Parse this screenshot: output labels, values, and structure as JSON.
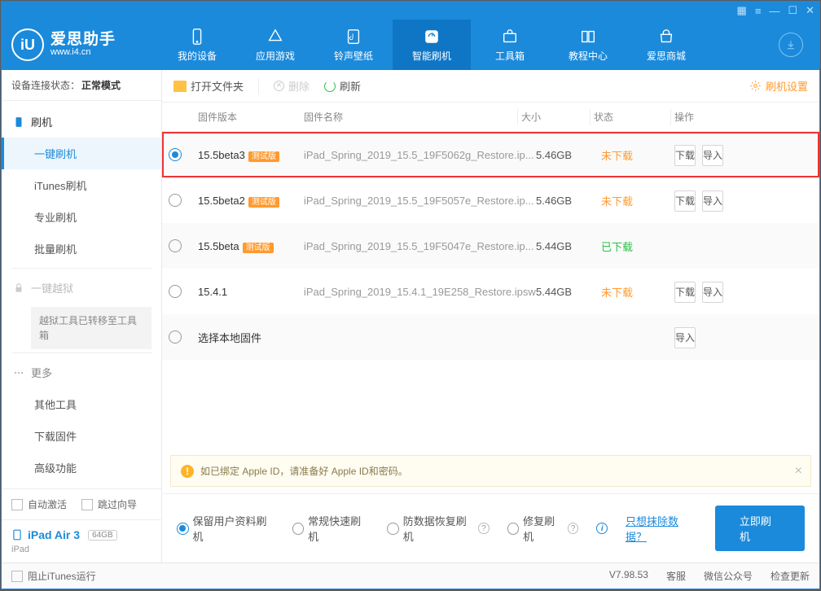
{
  "app": {
    "name": "爱思助手",
    "url": "www.i4.cn"
  },
  "nav": {
    "items": [
      {
        "label": "我的设备"
      },
      {
        "label": "应用游戏"
      },
      {
        "label": "铃声壁纸"
      },
      {
        "label": "智能刷机"
      },
      {
        "label": "工具箱"
      },
      {
        "label": "教程中心"
      },
      {
        "label": "爱思商城"
      }
    ]
  },
  "sidebar": {
    "conn_label": "设备连接状态：",
    "conn_value": "正常模式",
    "flash_head": "刷机",
    "items1": [
      "一键刷机",
      "iTunes刷机",
      "专业刷机",
      "批量刷机"
    ],
    "jb_head": "一键越狱",
    "jb_note": "越狱工具已转移至工具箱",
    "more_head": "更多",
    "items2": [
      "其他工具",
      "下载固件",
      "高级功能"
    ],
    "auto_activate": "自动激活",
    "skip_guide": "跳过向导",
    "device_name": "iPad Air 3",
    "device_cap": "64GB",
    "device_type": "iPad"
  },
  "toolbar": {
    "open": "打开文件夹",
    "delete": "删除",
    "refresh": "刷新",
    "settings": "刷机设置"
  },
  "table": {
    "h_ver": "固件版本",
    "h_name": "固件名称",
    "h_size": "大小",
    "h_status": "状态",
    "h_ops": "操作",
    "beta_tag": "测试版",
    "btn_dl": "下载",
    "btn_imp": "导入",
    "rows": [
      {
        "sel": true,
        "ver": "15.5beta3",
        "beta": true,
        "name": "iPad_Spring_2019_15.5_19F5062g_Restore.ip...",
        "size": "5.46GB",
        "status": "未下载",
        "status_cls": "nd",
        "dl": true,
        "imp": true
      },
      {
        "sel": false,
        "ver": "15.5beta2",
        "beta": true,
        "name": "iPad_Spring_2019_15.5_19F5057e_Restore.ip...",
        "size": "5.46GB",
        "status": "未下载",
        "status_cls": "nd",
        "dl": true,
        "imp": true
      },
      {
        "sel": false,
        "ver": "15.5beta",
        "beta": true,
        "name": "iPad_Spring_2019_15.5_19F5047e_Restore.ip...",
        "size": "5.44GB",
        "status": "已下载",
        "status_cls": "dl",
        "dl": false,
        "imp": false
      },
      {
        "sel": false,
        "ver": "15.4.1",
        "beta": false,
        "name": "iPad_Spring_2019_15.4.1_19E258_Restore.ipsw",
        "size": "5.44GB",
        "status": "未下载",
        "status_cls": "nd",
        "dl": true,
        "imp": true
      },
      {
        "sel": false,
        "ver": "选择本地固件",
        "beta": false,
        "name": "",
        "size": "",
        "status": "",
        "status_cls": "",
        "dl": false,
        "imp": true
      }
    ]
  },
  "notice": "如已绑定 Apple ID，请准备好 Apple ID和密码。",
  "options": {
    "o1": "保留用户资料刷机",
    "o2": "常规快速刷机",
    "o3": "防数据恢复刷机",
    "o4": "修复刷机",
    "link": "只想抹除数据？",
    "go": "立即刷机"
  },
  "statusbar": {
    "block_itunes": "阻止iTunes运行",
    "version": "V7.98.53",
    "service": "客服",
    "wechat": "微信公众号",
    "update": "检查更新"
  }
}
